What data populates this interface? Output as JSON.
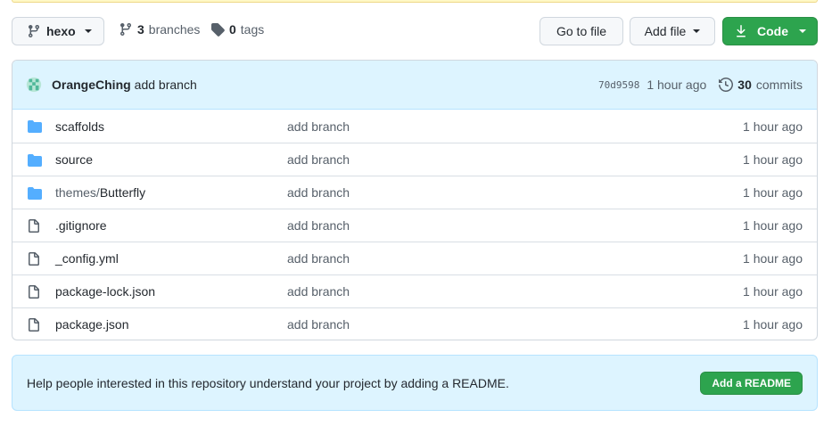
{
  "colors": {
    "accent_green": "#2da44e",
    "commit_bar_bg": "#ddf4ff",
    "folder_blue": "#54aeff",
    "muted_text": "#57606a"
  },
  "toolbar": {
    "branch_name": "hexo",
    "branches_count": "3",
    "branches_label": "branches",
    "tags_count": "0",
    "tags_label": "tags",
    "go_to_file_label": "Go to file",
    "add_file_label": "Add file",
    "code_label": "Code"
  },
  "commit": {
    "author": "OrangeChing",
    "message": "add branch",
    "sha": "70d9598",
    "age": "1 hour ago",
    "commits_count": "30",
    "commits_label": "commits"
  },
  "files": [
    {
      "type": "dir",
      "icon": "folder-icon",
      "name": "scaffolds",
      "prefix": "",
      "commit": "add branch",
      "age": "1 hour ago"
    },
    {
      "type": "dir",
      "icon": "folder-icon",
      "name": "source",
      "prefix": "",
      "commit": "add branch",
      "age": "1 hour ago"
    },
    {
      "type": "dir",
      "icon": "folder-icon",
      "name": "Butterfly",
      "prefix": "themes/",
      "commit": "add branch",
      "age": "1 hour ago"
    },
    {
      "type": "file",
      "icon": "file-icon",
      "name": ".gitignore",
      "prefix": "",
      "commit": "add branch",
      "age": "1 hour ago"
    },
    {
      "type": "file",
      "icon": "file-icon",
      "name": "_config.yml",
      "prefix": "",
      "commit": "add branch",
      "age": "1 hour ago"
    },
    {
      "type": "file",
      "icon": "file-icon",
      "name": "package-lock.json",
      "prefix": "",
      "commit": "add branch",
      "age": "1 hour ago"
    },
    {
      "type": "file",
      "icon": "file-icon",
      "name": "package.json",
      "prefix": "",
      "commit": "add branch",
      "age": "1 hour ago"
    }
  ],
  "readme": {
    "prompt": "Help people interested in this repository understand your project by adding a README.",
    "button_label": "Add a README"
  }
}
